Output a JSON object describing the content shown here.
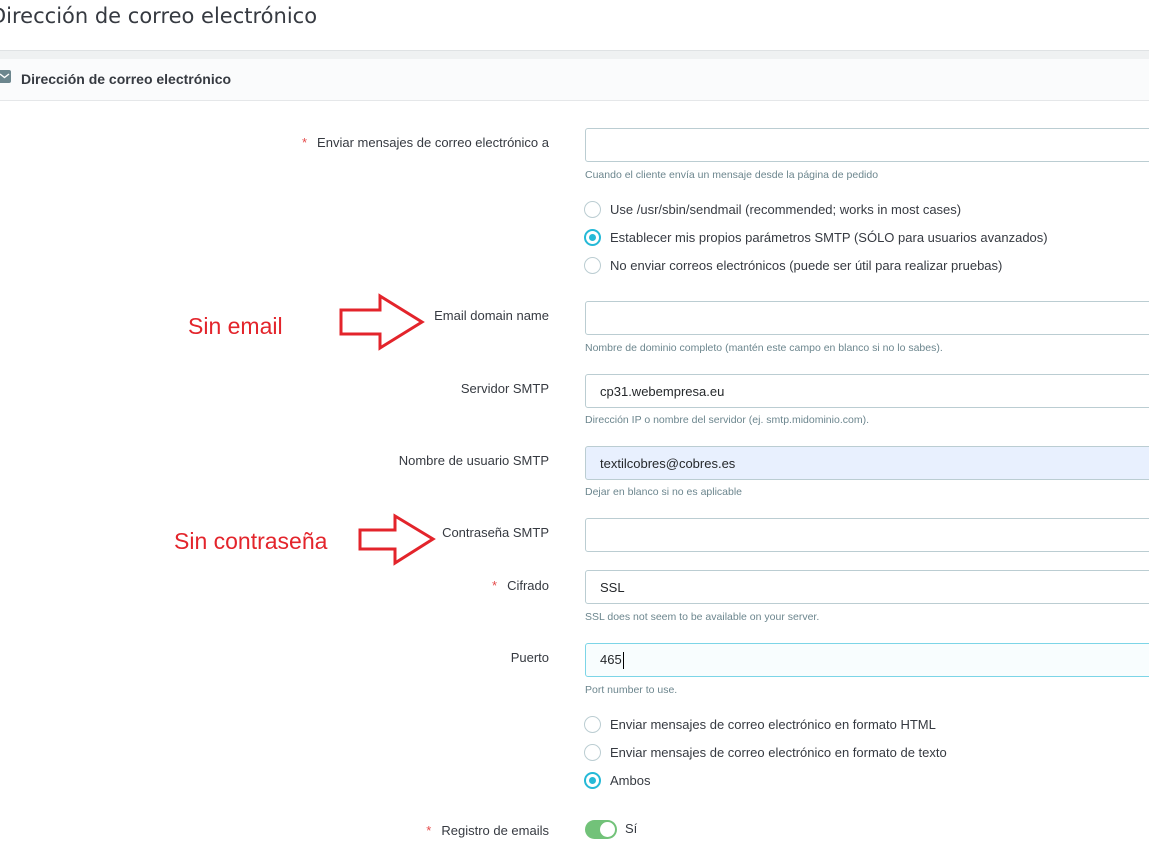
{
  "page_title": "Dirección de correo electrónico",
  "panel": {
    "title": "Dirección de correo electrónico",
    "icon": "envelope-icon"
  },
  "fields": {
    "send_to": {
      "label": "Enviar mensajes de correo electrónico a",
      "required": true,
      "value": "",
      "help": "Cuando el cliente envía un mensaje desde la página de pedido"
    },
    "email_domain": {
      "label": "Email domain name",
      "value": "",
      "help": "Nombre de dominio completo (mantén este campo en blanco si no lo sabes)."
    },
    "smtp_server": {
      "label": "Servidor SMTP",
      "value": "cp31.webempresa.eu",
      "help": "Dirección IP o nombre del servidor (ej. smtp.midominio.com)."
    },
    "smtp_user": {
      "label": "Nombre de usuario SMTP",
      "value": "textilcobres@cobres.es",
      "help": "Dejar en blanco si no es aplicable"
    },
    "smtp_password": {
      "label": "Contraseña SMTP",
      "value": ""
    },
    "encryption": {
      "label": "Cifrado",
      "required": true,
      "value": "SSL",
      "help": "SSL does not seem to be available on your server."
    },
    "port": {
      "label": "Puerto",
      "value": "465",
      "help": "Port number to use."
    },
    "email_log": {
      "label": "Registro de emails",
      "required": true,
      "toggle_label": "Sí",
      "enabled": true
    }
  },
  "mail_method_options": [
    {
      "label": "Use /usr/sbin/sendmail (recommended; works in most cases)",
      "checked": false
    },
    {
      "label": "Establecer mis propios parámetros SMTP (SÓLO para usuarios avanzados)",
      "checked": true
    },
    {
      "label": "No enviar correos electrónicos (puede ser útil para realizar pruebas)",
      "checked": false
    }
  ],
  "format_options": [
    {
      "label": "Enviar mensajes de correo electrónico en formato HTML",
      "checked": false
    },
    {
      "label": "Enviar mensajes de correo electrónico en formato de texto",
      "checked": false
    },
    {
      "label": "Ambos",
      "checked": true
    }
  ],
  "annotations": {
    "no_email": "Sin email",
    "no_password": "Sin contraseña"
  },
  "colors": {
    "accent": "#25b9d7",
    "required": "#e54b4b",
    "annotation": "#e3242b",
    "toggle_on": "#72c279"
  }
}
